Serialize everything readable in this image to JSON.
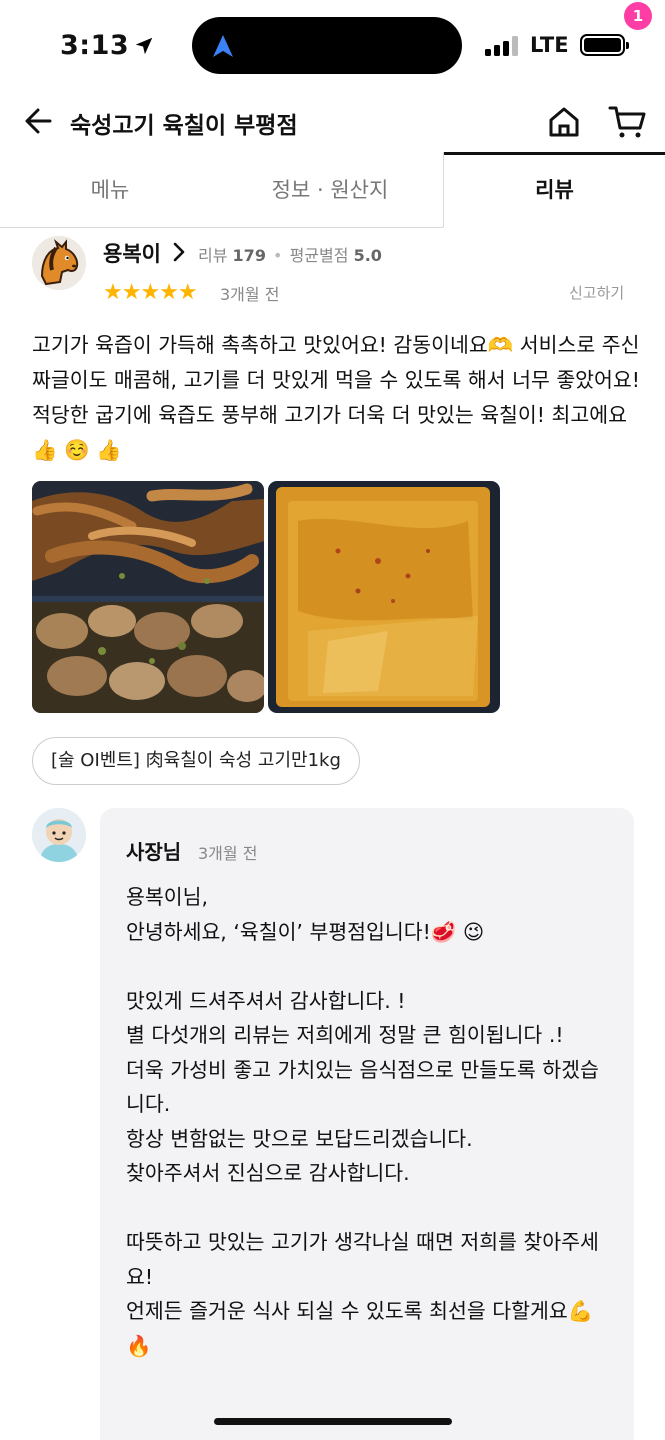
{
  "status_bar": {
    "time": "3:13",
    "network": "LTE"
  },
  "header": {
    "title": "숙성고기 육칠이 부평점",
    "cart_count": "1"
  },
  "tabs": [
    {
      "label": "메뉴"
    },
    {
      "label": "정보 · 원산지"
    },
    {
      "label": "리뷰"
    }
  ],
  "review": {
    "reviewer_name": "용복이",
    "review_count_label": "리뷰",
    "review_count": "179",
    "avg_label": "평균별점",
    "avg_rating": "5.0",
    "stars": "★★★★★",
    "rating": 5,
    "time": "3개월 전",
    "report": "신고하기",
    "text": "고기가 육즙이 가득해 촉촉하고 맛있어요! 감동이네요🫶 서비스로 주신 짜글이도 매콤해, 고기를 더 맛있게 먹을 수 있도록 해서 너무 좋았어요! 적당한 굽기에 육즙도 풍부해 고기가 더욱 더 맛있는 육칠이! 최고에요 👍 ☺️ 👍",
    "menu_chip": "[술 OI벤트] 肉육칠이 숙성 고기만1kg"
  },
  "reply": {
    "name": "사장님",
    "time": "3개월 전",
    "text": "용복이님,\n안녕하세요, ‘육칠이’ 부평점입니다!🥩 😉\n\n맛있게 드셔주셔서 감사합니다. !\n별 다섯개의 리뷰는 저희에게 정말 큰 힘이됩니다 .!\n더욱 가성비 좋고 가치있는 음식점으로 만들도록 하겠습니다.\n항상 변함없는 맛으로 보답드리겠습니다.\n찾아주셔서 진심으로 감사합니다.\n\n따뜻하고 맛있는 고기가 생각나실 때면 저희를 찾아주세요!\n언제든 즐거운 식사 되실 수 있도록 최선을 다할게요💪 🔥"
  },
  "colors": {
    "accent_pink": "#ff3ea5",
    "star": "#ffb400",
    "reply_bg": "#f3f3f5"
  }
}
